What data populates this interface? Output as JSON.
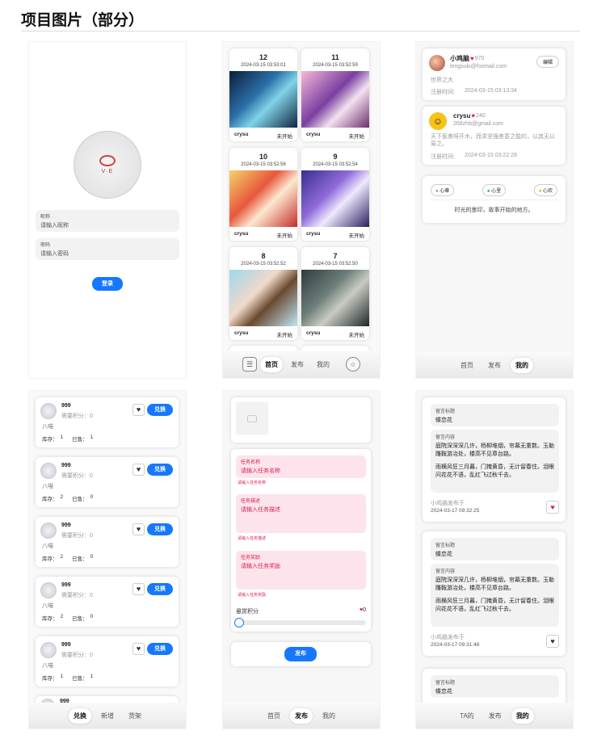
{
  "page_title": "项目图片（部分）",
  "login": {
    "nick_label": "昵称",
    "nick_placeholder": "请输入昵称",
    "pwd_label": "密码",
    "pwd_placeholder": "请输入密码",
    "btn": "登录",
    "logo": "V·E"
  },
  "tasks": {
    "cards": [
      {
        "num": "12",
        "date": "2024-03-15 03:53:01",
        "user": "crysu",
        "status": "未开始"
      },
      {
        "num": "11",
        "date": "2024-03-15 03:52:59",
        "user": "crysu",
        "status": "未开始"
      },
      {
        "num": "10",
        "date": "2024-03-15 03:52:56",
        "user": "crysu",
        "status": "未开始"
      },
      {
        "num": "9",
        "date": "2024-03-15 03:52:54",
        "user": "crysu",
        "status": "未开始"
      },
      {
        "num": "8",
        "date": "2024-03-15 03:52:52",
        "user": "crysu",
        "status": "未开始"
      },
      {
        "num": "7",
        "date": "2024-03-15 03:52:50",
        "user": "crysu",
        "status": "未开始"
      }
    ],
    "nav": {
      "home": "首页",
      "publish": "发布",
      "mine": "我的"
    }
  },
  "profile": {
    "u1": {
      "name": "小鸡脑",
      "score": "970",
      "email": "lengsuki@foxmail.com",
      "bio": "世界之大",
      "reg": "注册时间:",
      "time": "2024-03-15 03:13:34",
      "edit": "编辑"
    },
    "u2": {
      "name": "crysu",
      "score": "240",
      "email": "268zhb@gmail.com",
      "bio": "天下惹差呀开木，而求坚强差意之能的，以其无以易之。",
      "reg": "注册时间:",
      "time": "2024-03-15 03:22:28"
    },
    "moods": [
      "心章",
      "心里",
      "心欢"
    ],
    "slogan": "时光的墨印，故事开始的地方。",
    "nav": {
      "home": "首页",
      "publish": "发布",
      "mine": "我的"
    }
  },
  "rewards": {
    "items": [
      {
        "name": "999",
        "need": "需要积分：0",
        "desc": "八喵",
        "stock": "库存：",
        "stock_val": "1",
        "sold": "已售：",
        "sold_val": "1",
        "btn": "兑换"
      },
      {
        "name": "999",
        "need": "需要积分：0",
        "desc": "八喵",
        "stock": "库存：",
        "stock_val": "2",
        "sold": "已售：",
        "sold_val": "0",
        "btn": "兑换"
      },
      {
        "name": "999",
        "need": "需要积分：0",
        "desc": "八喵",
        "stock": "库存：",
        "stock_val": "2",
        "sold": "已售：",
        "sold_val": "0",
        "btn": "兑换"
      },
      {
        "name": "999",
        "need": "需要积分：0",
        "desc": "八喵",
        "stock": "库存：",
        "stock_val": "2",
        "sold": "已售：",
        "sold_val": "0",
        "btn": "兑换"
      },
      {
        "name": "999",
        "need": "需要积分：0",
        "desc": "八喵",
        "stock": "库存：",
        "stock_val": "1",
        "sold": "已售：",
        "sold_val": "1",
        "btn": "兑换"
      }
    ],
    "partial_name": "999",
    "nav": {
      "exchange": "兑换",
      "add": "新增",
      "goods": "货架"
    }
  },
  "publish": {
    "f1_label": "任务名称",
    "f1_ph": "请输入任务名称",
    "f1_hint": "请输入任务名称",
    "f2_label": "任务描述",
    "f2_ph": "请输入任务描述",
    "f2_hint": "请输入任务描述",
    "f3_label": "任务奖励",
    "f3_ph": "请输入任务奖励",
    "f3_hint": "请输入任务奖励",
    "slider_label": "悬赏积分",
    "slider_val": "0",
    "btn": "发布",
    "nav": {
      "home": "首页",
      "publish": "发布",
      "mine": "我的"
    }
  },
  "messages": {
    "items": [
      {
        "title_label": "留言标题",
        "title": "蝶恋花",
        "content_label": "留言内容",
        "p1": "庭院深深深几许，杨柳堆烟，帘幕无重数。玉勒雕鞍游冶处，楼高不见章台路。",
        "p2": "雨横风狂三月暮，门掩黄昏，无计留春住。泪眼问花花不语，乱红飞过秋千去。",
        "author": "小鸡脑发布于",
        "time": "2024-03-17 09:32:25"
      },
      {
        "title_label": "留言标题",
        "title": "蝶恋花",
        "content_label": "留言内容",
        "p1": "庭院深深深几许，杨柳堆烟，帘幕无重数。玉勒雕鞍游冶处，楼高不见章台路。",
        "p2": "雨横风狂三月暮，门掩黄昏，无计留春住。泪眼问花花不语，乱红飞过秋千去。",
        "author": "小鸡脑发布于",
        "time": "2024-03-17 09:31:48"
      }
    ],
    "partial": {
      "title_label": "留言标题",
      "title": "蝶恋花"
    },
    "nav": {
      "ta": "TA的",
      "publish": "发布",
      "mine": "我的"
    }
  },
  "colors": {
    "accent": "#1677ff",
    "heart": "#e0203a",
    "pink_field": "#fde4ec",
    "pink_text": "#d8204c"
  }
}
